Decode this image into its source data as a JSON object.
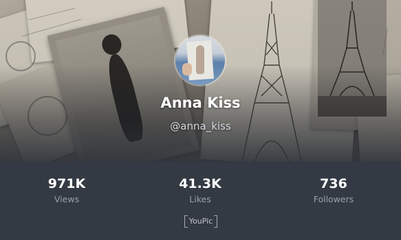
{
  "profile": {
    "name": "Anna Kiss",
    "handle": "@anna_kiss"
  },
  "stats": [
    {
      "value": "971K",
      "label": "Views"
    },
    {
      "value": "41.3K",
      "label": "Likes"
    },
    {
      "value": "736",
      "label": "Followers"
    }
  ],
  "brand": {
    "logo_text": "YouPic"
  },
  "colors": {
    "background": "#343a43",
    "text_primary": "#ffffff",
    "text_secondary": "#9aa0a9"
  }
}
